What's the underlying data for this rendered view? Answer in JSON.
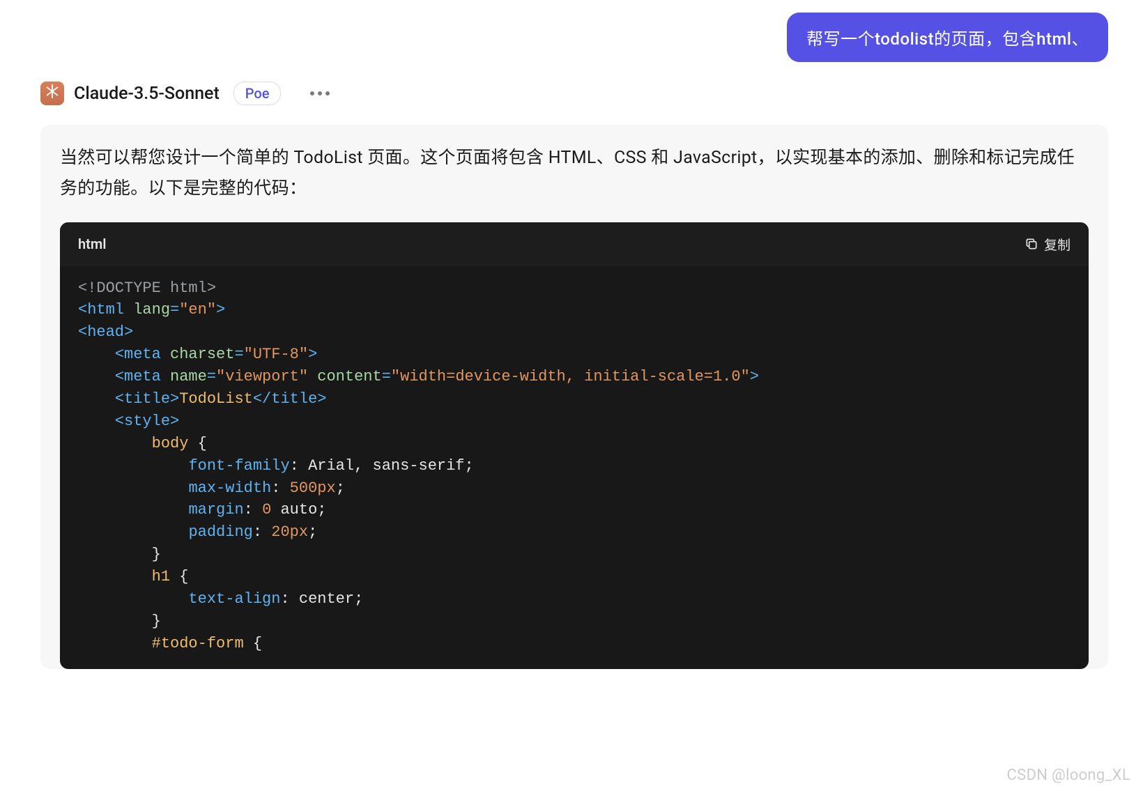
{
  "user_message": "帮写一个todolist的页面，包含html、",
  "assistant": {
    "name": "Claude-3.5-Sonnet",
    "badge": "Poe",
    "avatar_icon": "asterisk-icon"
  },
  "response": {
    "intro_text": "当然可以帮您设计一个简单的 TodoList 页面。这个页面将包含 HTML、CSS 和 JavaScript，以实现基本的添加、删除和标记完成任务的功能。以下是完整的代码：",
    "code_lang": "html",
    "copy_label": "复制",
    "code_tokens": [
      [
        {
          "c": "tok-doctype",
          "t": "<!DOCTYPE html>"
        }
      ],
      [
        {
          "c": "tok-tag",
          "t": "<html "
        },
        {
          "c": "tok-attr",
          "t": "lang"
        },
        {
          "c": "tok-tag",
          "t": "="
        },
        {
          "c": "tok-string",
          "t": "\"en\""
        },
        {
          "c": "tok-tag",
          "t": ">"
        }
      ],
      [
        {
          "c": "tok-tag",
          "t": "<head>"
        }
      ],
      [
        {
          "c": "tok-plain",
          "t": "    "
        },
        {
          "c": "tok-tag",
          "t": "<meta "
        },
        {
          "c": "tok-attr",
          "t": "charset"
        },
        {
          "c": "tok-tag",
          "t": "="
        },
        {
          "c": "tok-string",
          "t": "\"UTF-8\""
        },
        {
          "c": "tok-tag",
          "t": ">"
        }
      ],
      [
        {
          "c": "tok-plain",
          "t": "    "
        },
        {
          "c": "tok-tag",
          "t": "<meta "
        },
        {
          "c": "tok-attr",
          "t": "name"
        },
        {
          "c": "tok-tag",
          "t": "="
        },
        {
          "c": "tok-string",
          "t": "\"viewport\""
        },
        {
          "c": "tok-tag",
          "t": " "
        },
        {
          "c": "tok-attr",
          "t": "content"
        },
        {
          "c": "tok-tag",
          "t": "="
        },
        {
          "c": "tok-string",
          "t": "\"width=device-width, initial-scale=1.0\""
        },
        {
          "c": "tok-tag",
          "t": ">"
        }
      ],
      [
        {
          "c": "tok-plain",
          "t": "    "
        },
        {
          "c": "tok-tag",
          "t": "<title>"
        },
        {
          "c": "tok-text",
          "t": "TodoList"
        },
        {
          "c": "tok-tag",
          "t": "</title>"
        }
      ],
      [
        {
          "c": "tok-plain",
          "t": "    "
        },
        {
          "c": "tok-tag",
          "t": "<style>"
        }
      ],
      [
        {
          "c": "tok-plain",
          "t": "        "
        },
        {
          "c": "tok-selector",
          "t": "body"
        },
        {
          "c": "tok-plain",
          "t": " "
        },
        {
          "c": "tok-brace",
          "t": "{"
        }
      ],
      [
        {
          "c": "tok-plain",
          "t": "            "
        },
        {
          "c": "tok-property",
          "t": "font-family"
        },
        {
          "c": "tok-plain",
          "t": ": Arial, sans-serif;"
        }
      ],
      [
        {
          "c": "tok-plain",
          "t": "            "
        },
        {
          "c": "tok-property",
          "t": "max-width"
        },
        {
          "c": "tok-plain",
          "t": ": "
        },
        {
          "c": "tok-number",
          "t": "500px"
        },
        {
          "c": "tok-plain",
          "t": ";"
        }
      ],
      [
        {
          "c": "tok-plain",
          "t": "            "
        },
        {
          "c": "tok-property",
          "t": "margin"
        },
        {
          "c": "tok-plain",
          "t": ": "
        },
        {
          "c": "tok-number",
          "t": "0"
        },
        {
          "c": "tok-plain",
          "t": " auto;"
        }
      ],
      [
        {
          "c": "tok-plain",
          "t": "            "
        },
        {
          "c": "tok-property",
          "t": "padding"
        },
        {
          "c": "tok-plain",
          "t": ": "
        },
        {
          "c": "tok-number",
          "t": "20px"
        },
        {
          "c": "tok-plain",
          "t": ";"
        }
      ],
      [
        {
          "c": "tok-plain",
          "t": "        "
        },
        {
          "c": "tok-brace",
          "t": "}"
        }
      ],
      [
        {
          "c": "tok-plain",
          "t": "        "
        },
        {
          "c": "tok-selector",
          "t": "h1"
        },
        {
          "c": "tok-plain",
          "t": " "
        },
        {
          "c": "tok-brace",
          "t": "{"
        }
      ],
      [
        {
          "c": "tok-plain",
          "t": "            "
        },
        {
          "c": "tok-property",
          "t": "text-align"
        },
        {
          "c": "tok-plain",
          "t": ": center;"
        }
      ],
      [
        {
          "c": "tok-plain",
          "t": "        "
        },
        {
          "c": "tok-brace",
          "t": "}"
        }
      ],
      [
        {
          "c": "tok-plain",
          "t": "        "
        },
        {
          "c": "tok-selector",
          "t": "#todo-form"
        },
        {
          "c": "tok-plain",
          "t": " "
        },
        {
          "c": "tok-brace",
          "t": "{"
        }
      ]
    ]
  },
  "watermark": "CSDN @loong_XL"
}
